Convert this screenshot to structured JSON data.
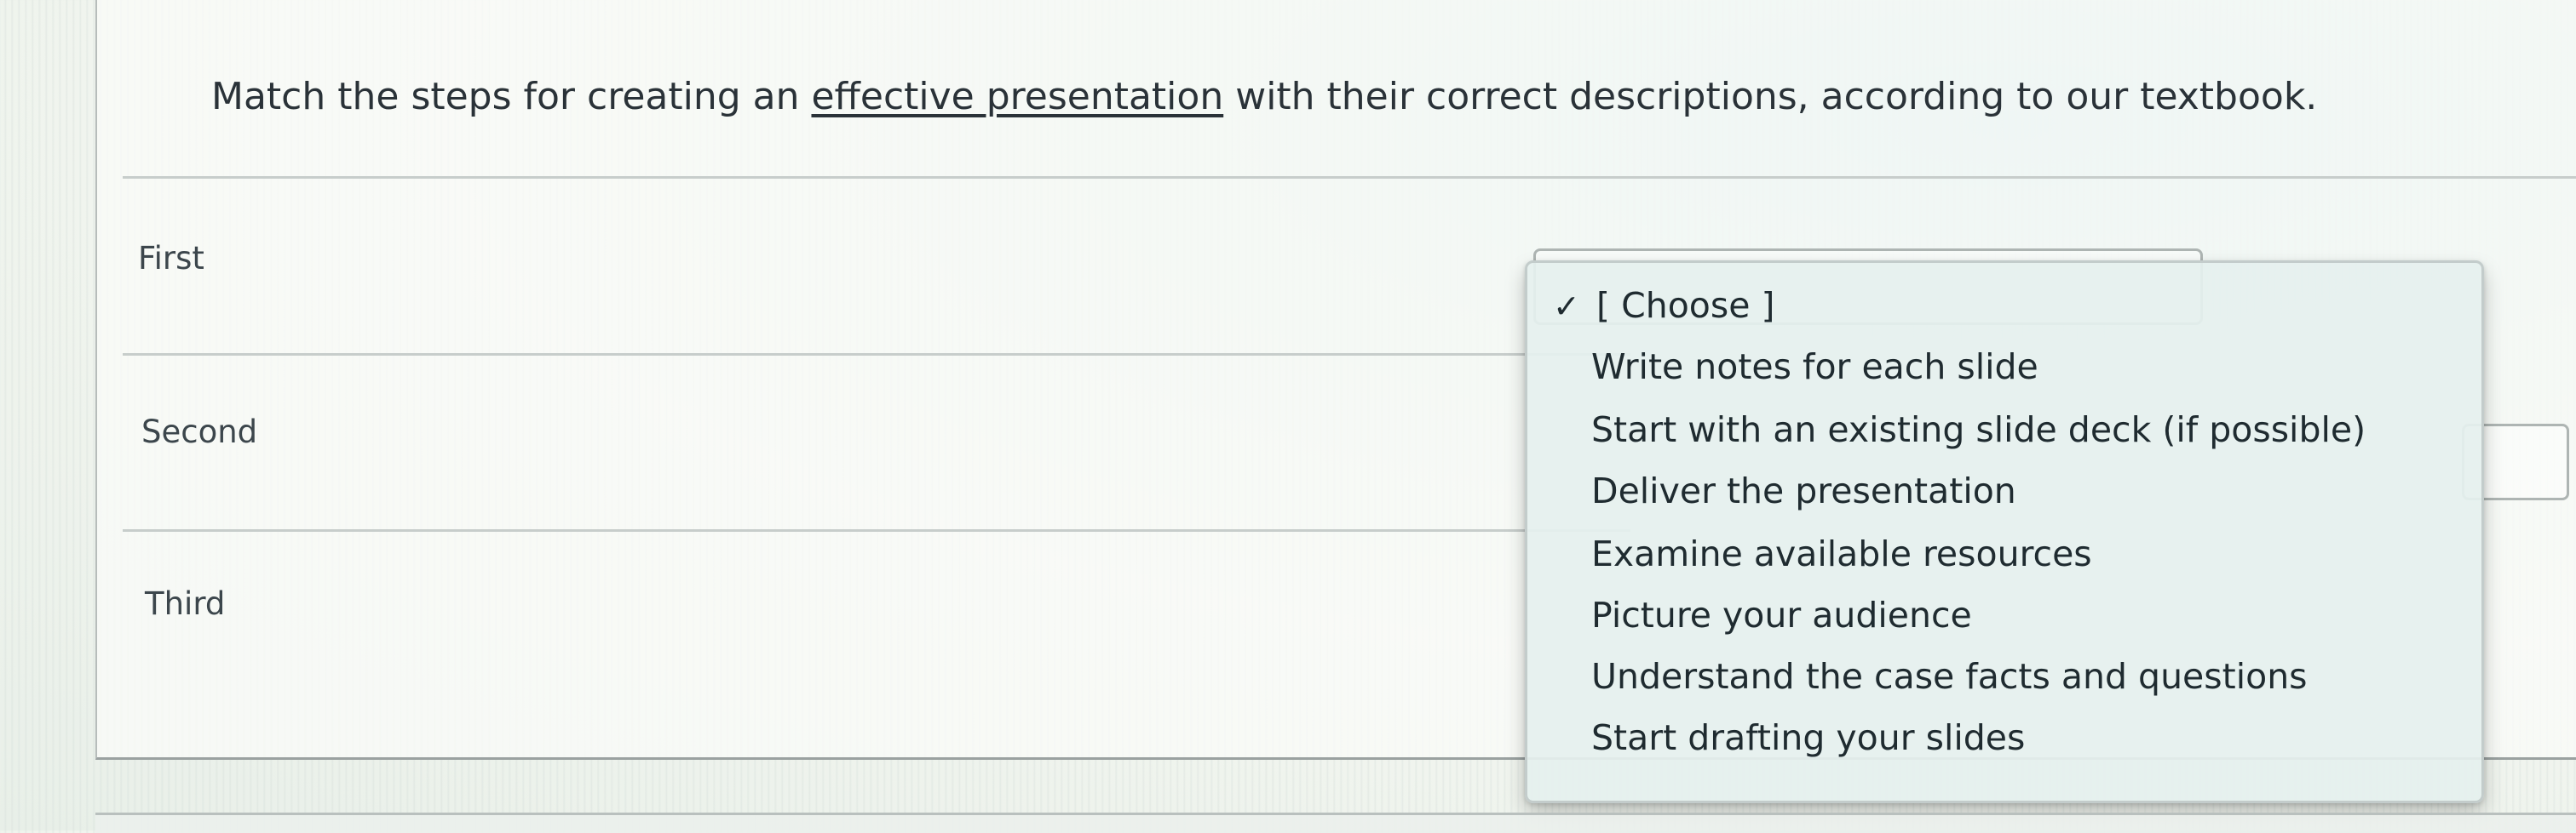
{
  "question": {
    "prefix": "Match the steps for creating an ",
    "link_text": "effective presentation",
    "suffix": " with their correct descriptions, according to our textbook."
  },
  "rows": [
    {
      "label": "First"
    },
    {
      "label": "Second"
    },
    {
      "label": "Third"
    }
  ],
  "dropdown": {
    "selected": "[ Choose ]",
    "options": [
      "Write notes for each slide",
      "Start with an existing slide deck (if possible)",
      "Deliver the presentation",
      "Examine available resources",
      "Picture your audience",
      "Understand the case facts and questions",
      "Start drafting your slides"
    ]
  },
  "icons": {
    "selected_marker": "check-icon"
  }
}
